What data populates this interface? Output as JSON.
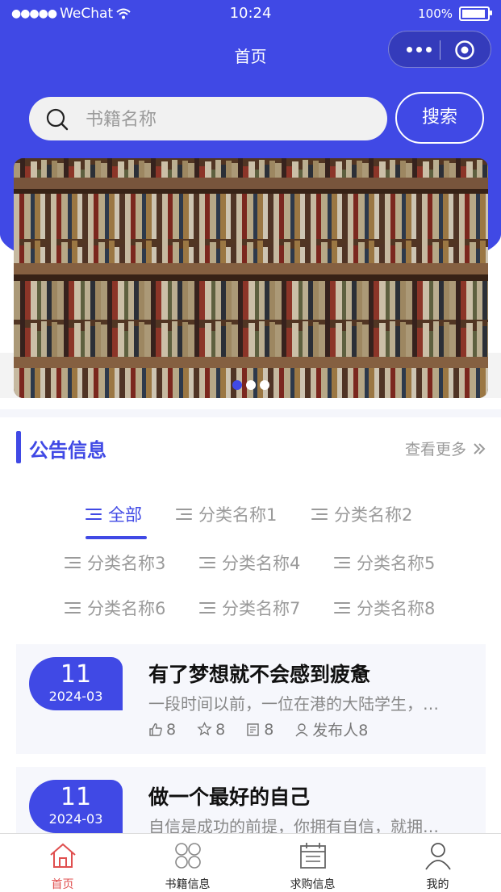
{
  "status_bar": {
    "carrier": "WeChat",
    "time": "10:24",
    "battery": "100%"
  },
  "nav": {
    "title": "首页",
    "capsule_more_icon": "more-dots-icon",
    "capsule_close_icon": "target-circle-icon"
  },
  "search": {
    "placeholder": "书籍名称",
    "button_label": "搜索"
  },
  "banner": {
    "slides": 3,
    "active_index": 0
  },
  "notice_section": {
    "title": "公告信息",
    "more_label": "查看更多"
  },
  "categories": [
    {
      "label": "全部",
      "active": true
    },
    {
      "label": "分类名称1"
    },
    {
      "label": "分类名称2"
    },
    {
      "label": "分类名称3"
    },
    {
      "label": "分类名称4"
    },
    {
      "label": "分类名称5"
    },
    {
      "label": "分类名称6"
    },
    {
      "label": "分类名称7"
    },
    {
      "label": "分类名称8"
    }
  ],
  "articles": [
    {
      "day": "11",
      "month": "2024-03",
      "title": "有了梦想就不会感到疲惫",
      "desc": "一段时间以前，一位在港的大陆学生，…",
      "likes": "8",
      "stars": "8",
      "views": "8",
      "author": "发布人8"
    },
    {
      "day": "11",
      "month": "2024-03",
      "title": "做一个最好的自己",
      "desc": "自信是成功的前提，你拥有自信，就拥…"
    }
  ],
  "tabbar": [
    {
      "label": "首页",
      "icon": "home-icon",
      "active": true
    },
    {
      "label": "书籍信息",
      "icon": "grid-icon"
    },
    {
      "label": "求购信息",
      "icon": "calendar-icon"
    },
    {
      "label": "我的",
      "icon": "user-icon"
    }
  ],
  "colors": {
    "primary": "#4049e5",
    "tab_active": "#e04f4f",
    "card_bg": "#f6f7fc"
  }
}
